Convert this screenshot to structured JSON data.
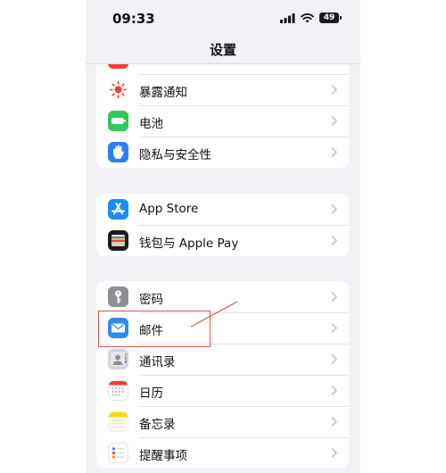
{
  "status_bar": {
    "time": "09:33",
    "battery": "49",
    "icons": [
      "signal-icon",
      "wifi-icon",
      "battery-icon"
    ]
  },
  "nav": {
    "title": "设置"
  },
  "groups": [
    {
      "items": [
        {
          "label": "",
          "icon": "partial-red-icon",
          "color": "#ff3b30"
        },
        {
          "label": "暴露通知",
          "icon": "exposure-notification-icon",
          "color": "#ffffff"
        },
        {
          "label": "电池",
          "icon": "battery-icon",
          "color": "#34c759"
        },
        {
          "label": "隐私与安全性",
          "icon": "hand-icon",
          "color": "#2f7cf6"
        }
      ]
    },
    {
      "items": [
        {
          "label": "App Store",
          "icon": "app-store-icon",
          "color": "#1e8cf5"
        },
        {
          "label": "钱包与 Apple Pay",
          "icon": "wallet-icon",
          "color": "#1c1c1e"
        }
      ]
    },
    {
      "items": [
        {
          "label": "密码",
          "icon": "key-icon",
          "color": "#8e8e93"
        },
        {
          "label": "邮件",
          "icon": "mail-icon",
          "color": "#2d8cf0"
        },
        {
          "label": "通讯录",
          "icon": "contacts-icon",
          "color": "#c8c8cc"
        },
        {
          "label": "日历",
          "icon": "calendar-icon",
          "color": "#ffffff"
        },
        {
          "label": "备忘录",
          "icon": "notes-icon",
          "color": "#ffd60a"
        },
        {
          "label": "提醒事项",
          "icon": "reminders-icon",
          "color": "#ffffff"
        }
      ]
    }
  ],
  "annotation": {
    "color": "#d9534f",
    "target": "邮件"
  },
  "colors": {
    "background": "#f2f2f6",
    "card": "#ffffff",
    "chevron": "#c4c4c7"
  }
}
